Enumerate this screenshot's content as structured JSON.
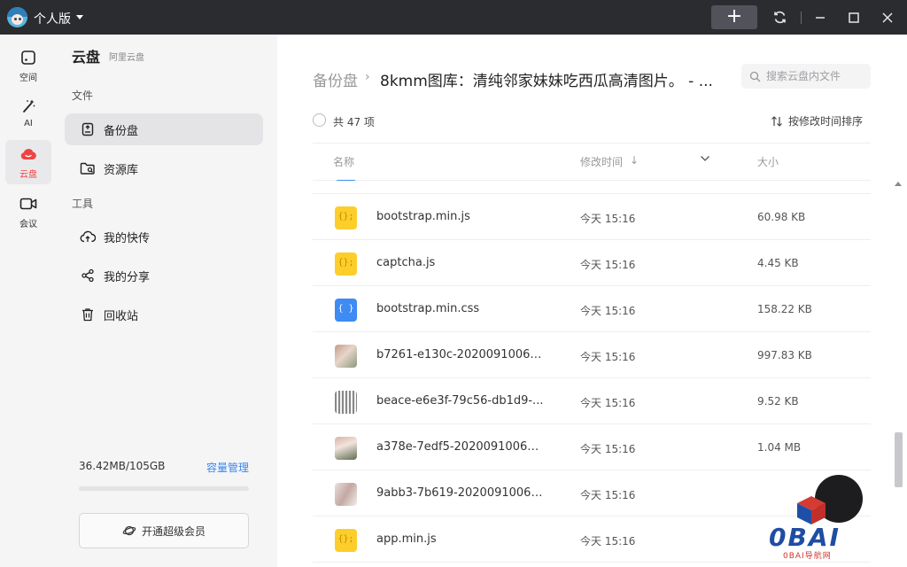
{
  "titlebar": {
    "title": "个人版"
  },
  "rail": {
    "items": [
      {
        "label": "空间",
        "icon": "space-icon",
        "active": false
      },
      {
        "label": "AI",
        "icon": "ai-wand-icon",
        "active": false
      },
      {
        "label": "云盘",
        "icon": "cloud-drive-icon",
        "active": true
      },
      {
        "label": "会议",
        "icon": "video-camera-icon",
        "active": false
      }
    ]
  },
  "sidebar": {
    "title": "云盘",
    "subtitle": "阿里云盘",
    "group_files": "文件",
    "group_tools": "工具",
    "items": [
      {
        "label": "备份盘",
        "icon": "backup-disk-icon",
        "active": true
      },
      {
        "label": "资源库",
        "icon": "resource-folder-icon",
        "active": false
      },
      {
        "label": "我的快传",
        "icon": "cloud-upload-icon",
        "active": false
      },
      {
        "label": "我的分享",
        "icon": "share-icon",
        "active": false
      },
      {
        "label": "回收站",
        "icon": "trash-icon",
        "active": false
      }
    ],
    "storage_used": "36.42MB/105GB",
    "storage_manage": "容量管理",
    "storage_fraction": 0.0003,
    "vip_button": "开通超级会员"
  },
  "main": {
    "breadcrumb_root": "备份盘",
    "breadcrumb_current": "8kmm图库：清纯邻家妹妹吃西瓜高清图片。 - ...",
    "search_placeholder": "搜索云盘内文件",
    "item_count": "共 47 项",
    "sort_label": "按修改时间排序",
    "columns": {
      "name": "名称",
      "modified": "修改时间",
      "size": "大小"
    },
    "files": [
      {
        "name": "bootstrap.min.js",
        "time": "今天 15:16",
        "size": "60.98 KB",
        "type": "js"
      },
      {
        "name": "captcha.js",
        "time": "今天 15:16",
        "size": "4.45 KB",
        "type": "js"
      },
      {
        "name": "bootstrap.min.css",
        "time": "今天 15:16",
        "size": "158.22 KB",
        "type": "css"
      },
      {
        "name": "b7261-e130c-20200910061...",
        "time": "今天 15:16",
        "size": "997.83 KB",
        "type": "img1"
      },
      {
        "name": "beace-e6e3f-79c56-db1d9-...",
        "time": "今天 15:16",
        "size": "9.52 KB",
        "type": "img2"
      },
      {
        "name": "a378e-7edf5-20200910061...",
        "time": "今天 15:16",
        "size": "1.04 MB",
        "type": "img3"
      },
      {
        "name": "9abb3-7b619-20200910061...",
        "time": "今天 15:16",
        "size": "",
        "type": "img4"
      },
      {
        "name": "app.min.js",
        "time": "今天 15:16",
        "size": "",
        "type": "js"
      }
    ]
  },
  "watermark": {
    "text": "0BAI",
    "sub": "0BAI导航网"
  },
  "colors": {
    "accent": "#ef4343",
    "link": "#3a86f0",
    "titlebar": "#2b2c30",
    "js_icon": "#fbce2c",
    "css_icon": "#3d8bf3"
  }
}
